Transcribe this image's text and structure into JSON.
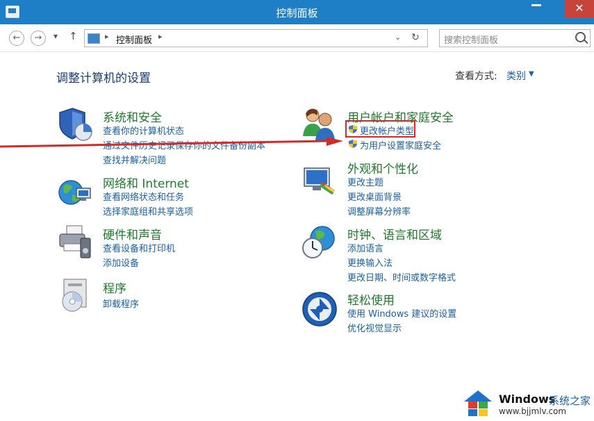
{
  "window": {
    "title": "控制面板",
    "close_symbol": "✕"
  },
  "navbar": {
    "back_symbol": "←",
    "forward_symbol": "→",
    "dropdown_symbol": "▾",
    "up_symbol": "↑",
    "breadcrumb_sep": "▸",
    "breadcrumb_item": "控制面板",
    "address_dropdown": "⌄",
    "refresh_symbol": "↻",
    "search_placeholder": "搜索控制面板"
  },
  "header": {
    "title": "调整计算机的设置",
    "view_by_label": "查看方式:",
    "view_by_value": "类别",
    "view_by_arrow": "▼"
  },
  "categories": {
    "system_security": {
      "title": "系统和安全",
      "links": [
        "查看你的计算机状态",
        "通过文件历史记录保存你的文件备份副本",
        "查找并解决问题"
      ]
    },
    "network": {
      "title": "网络和 Internet",
      "links": [
        "查看网络状态和任务",
        "选择家庭组和共享选项"
      ]
    },
    "hardware_sound": {
      "title": "硬件和声音",
      "links": [
        "查看设备和打印机",
        "添加设备"
      ]
    },
    "programs": {
      "title": "程序",
      "links": [
        "卸载程序"
      ]
    },
    "user_accounts": {
      "title": "用户帐户和家庭安全",
      "links": [
        "更改帐户类型",
        "为用户设置家庭安全"
      ]
    },
    "appearance": {
      "title": "外观和个性化",
      "links": [
        "更改主题",
        "更改桌面背景",
        "调整屏幕分辨率"
      ]
    },
    "clock_region": {
      "title": "时钟、语言和区域",
      "links": [
        "添加语言",
        "更换输入法",
        "更改日期、时间或数字格式"
      ]
    },
    "ease_of_access": {
      "title": "轻松使用",
      "links": [
        "使用 Windows 建议的设置",
        "优化视觉显示"
      ]
    }
  },
  "watermark": {
    "brand": "Windows",
    "site_cn": "系统之家",
    "url": "www.bjjmlv.com"
  },
  "colors": {
    "titlebar": "#1f7fc6",
    "category_title": "#1f7a2b",
    "link": "#1a5fa8",
    "annotation": "#d42a2a"
  }
}
